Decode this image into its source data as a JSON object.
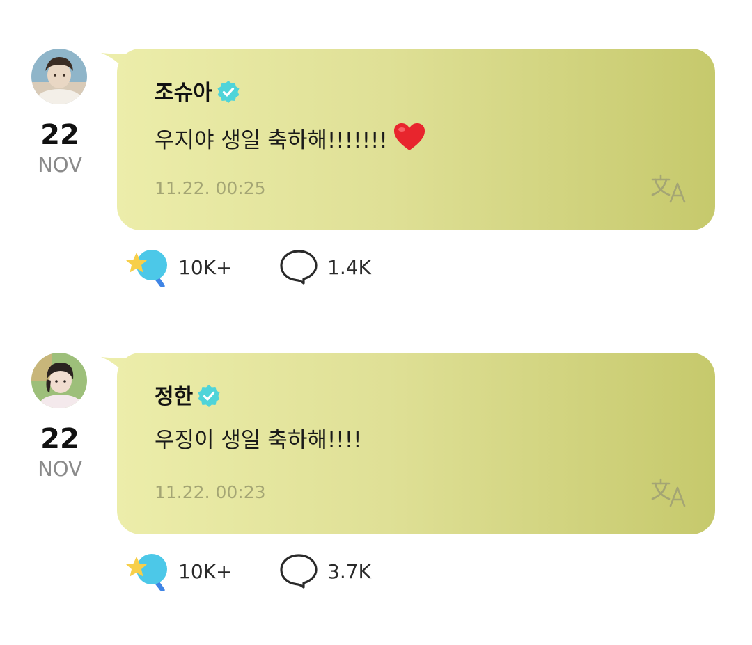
{
  "posts": [
    {
      "author": "조슈아",
      "date_day": "22",
      "date_month": "NOV",
      "message": "우지야 생일 축하해!!!!!!!",
      "message_emoji": "heart",
      "timestamp": "11.22. 00:25",
      "likes": "10K+",
      "comments": "1.4K",
      "avatar_colors": [
        "#8fb5c9",
        "#e9d7c4",
        "#3b2d24"
      ]
    },
    {
      "author": "정한",
      "date_day": "22",
      "date_month": "NOV",
      "message": "우징이 생일 축하해!!!!",
      "message_emoji": "",
      "timestamp": "11.22. 00:23",
      "likes": "10K+",
      "comments": "3.7K",
      "avatar_colors": [
        "#9dbf7a",
        "#f1ddd0",
        "#2a2220"
      ]
    }
  ],
  "colors": {
    "bubble_start": "#ecedaa",
    "bubble_end": "#c6c96c",
    "verified_badge": "#4fd4d9",
    "timestamp": "#a4a574",
    "heart": "#e8252d",
    "like_blue": "#4cc8e8",
    "like_star": "#f7cf4a"
  },
  "icons": {
    "verified": "verified-badge-icon",
    "translate": "translate-icon",
    "like": "fan-like-icon",
    "comment": "comment-bubble-icon"
  }
}
